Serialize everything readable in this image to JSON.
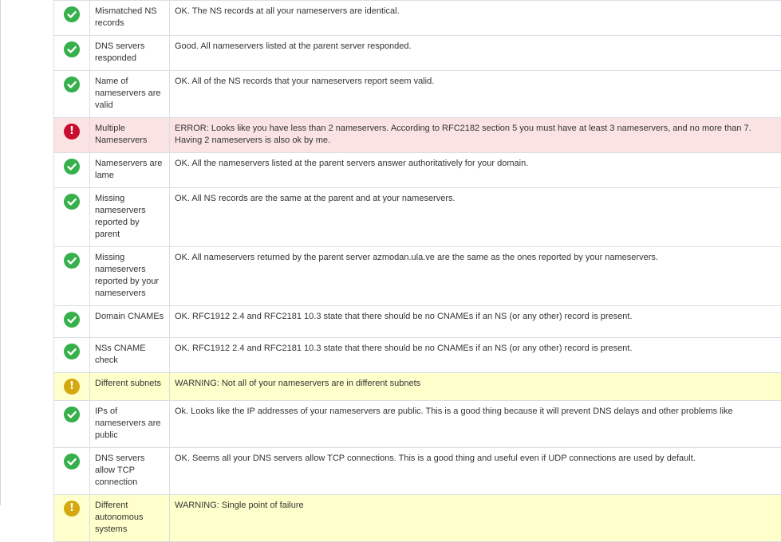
{
  "colors": {
    "ok": "#35b04b",
    "error": "#c8102e",
    "warning": "#d4a80f",
    "error_row_bg": "#fbe3e4",
    "warning_row_bg": "#ffffcc"
  },
  "rows": [
    {
      "status": "ok",
      "icon": "check-circle-icon",
      "name": "Mismatched NS records",
      "message": "OK. The NS records at all your nameservers are identical."
    },
    {
      "status": "ok",
      "icon": "check-circle-icon",
      "name": "DNS servers responded",
      "message": "Good. All nameservers listed at the parent server responded."
    },
    {
      "status": "ok",
      "icon": "check-circle-icon",
      "name": "Name of nameservers are valid",
      "message": "OK. All of the NS records that your nameservers report seem valid."
    },
    {
      "status": "error",
      "icon": "error-circle-icon",
      "name": "Multiple Nameservers",
      "message": "ERROR: Looks like you have less than 2 nameservers. According to RFC2182 section 5 you must have at least 3 nameservers, and no more than 7. Having 2 nameservers is also ok by me."
    },
    {
      "status": "ok",
      "icon": "check-circle-icon",
      "name": "Nameservers are lame",
      "message": "OK. All the nameservers listed at the parent servers answer authoritatively for your domain."
    },
    {
      "status": "ok",
      "icon": "check-circle-icon",
      "name": "Missing nameservers reported by parent",
      "message": "OK. All NS records are the same at the parent and at your nameservers."
    },
    {
      "status": "ok",
      "icon": "check-circle-icon",
      "name": "Missing nameservers reported by your nameservers",
      "message": "OK. All nameservers returned by the parent server azmodan.ula.ve are the same as the ones reported by your nameservers."
    },
    {
      "status": "ok",
      "icon": "check-circle-icon",
      "name": "Domain CNAMEs",
      "message": "OK. RFC1912 2.4 and RFC2181 10.3 state that there should be no CNAMEs if an NS (or any other) record is present."
    },
    {
      "status": "ok",
      "icon": "check-circle-icon",
      "name": "NSs CNAME check",
      "message": "OK. RFC1912 2.4 and RFC2181 10.3 state that there should be no CNAMEs if an NS (or any other) record is present."
    },
    {
      "status": "warning",
      "icon": "warning-circle-icon",
      "name": "Different subnets",
      "message": "WARNING: Not all of your nameservers are in different subnets"
    },
    {
      "status": "ok",
      "icon": "check-circle-icon",
      "name": "IPs of nameservers are public",
      "message": "Ok. Looks like the IP addresses of your nameservers are public. This is a good thing because it will prevent DNS delays and other problems like"
    },
    {
      "status": "ok",
      "icon": "check-circle-icon",
      "name": "DNS servers allow TCP connection",
      "message": "OK. Seems all your DNS servers allow TCP connections. This is a good thing and useful even if UDP connections are used by default."
    },
    {
      "status": "warning",
      "icon": "warning-circle-icon",
      "name": "Different autonomous systems",
      "message": "WARNING: Single point of failure"
    }
  ]
}
